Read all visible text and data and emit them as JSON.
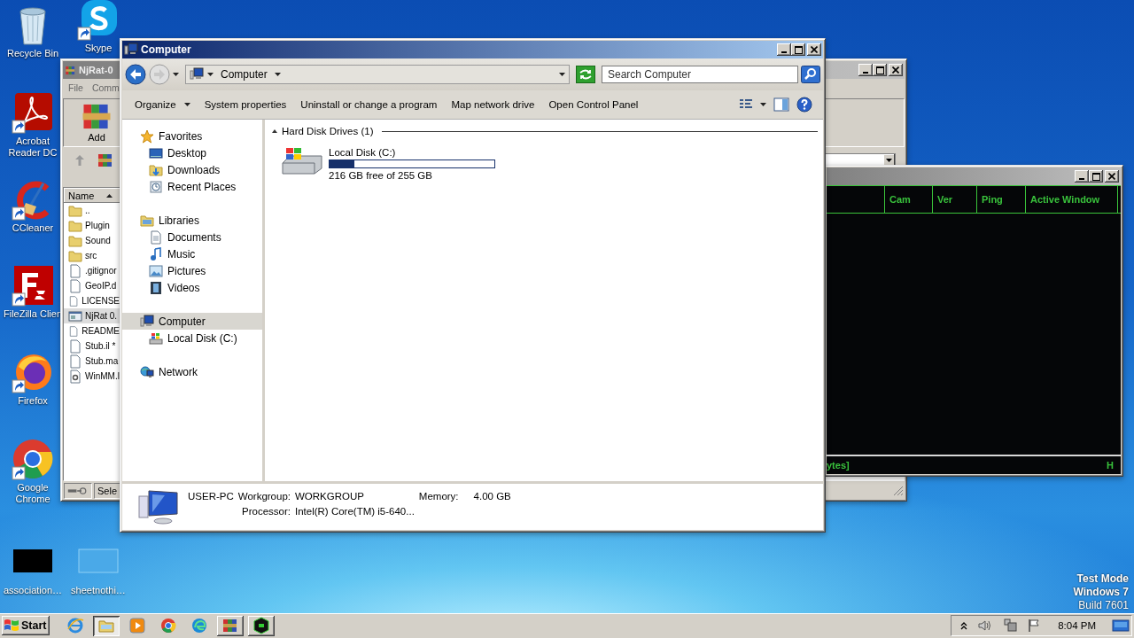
{
  "desktop": {
    "icons": [
      {
        "label": "Recycle Bin",
        "kind": "recycle"
      },
      {
        "label": "Skype",
        "kind": "skype"
      },
      {
        "label": "Acrobat Reader DC",
        "kind": "acrobat"
      },
      {
        "label": "CCleaner",
        "kind": "ccleaner"
      },
      {
        "label": "FileZilla Clien",
        "kind": "filezilla"
      },
      {
        "label": "Firefox",
        "kind": "firefox"
      },
      {
        "label": "Google Chrome",
        "kind": "chrome"
      },
      {
        "label": "association…",
        "kind": "blackfile"
      },
      {
        "label": "sheetnothi…",
        "kind": "blankfile"
      }
    ],
    "notice": [
      "Test Mode",
      "Windows 7",
      "Build 7601"
    ]
  },
  "archiver": {
    "title": "NjRat-0",
    "menu": [
      "File",
      "Comm"
    ],
    "toolbar": [
      "Add"
    ],
    "column": "Name",
    "files": [
      {
        "name": "..",
        "kind": "folder",
        "selected": false
      },
      {
        "name": "Plugin",
        "kind": "folder",
        "selected": false
      },
      {
        "name": "Sound",
        "kind": "folder",
        "selected": false
      },
      {
        "name": "src",
        "kind": "folder",
        "selected": false
      },
      {
        "name": ".gitignor",
        "kind": "file",
        "selected": false
      },
      {
        "name": "GeoIP.d",
        "kind": "file",
        "selected": false
      },
      {
        "name": "LICENSE",
        "kind": "file",
        "selected": false
      },
      {
        "name": "NjRat 0.",
        "kind": "app",
        "selected": true
      },
      {
        "name": "README",
        "kind": "file",
        "selected": false
      },
      {
        "name": "Stub.il *",
        "kind": "file",
        "selected": false
      },
      {
        "name": "Stub.ma",
        "kind": "file",
        "selected": false
      },
      {
        "name": "WinMM.l",
        "kind": "dll",
        "selected": false
      }
    ],
    "status": "Sele"
  },
  "rat_window": {
    "columns": [
      "Cam",
      "Ver",
      "Ping",
      "Active Window"
    ],
    "status_left": "ytes]",
    "status_right": "H"
  },
  "explorer": {
    "title": "Computer",
    "address": "Computer",
    "search": {
      "placeholder": "Search Computer"
    },
    "toolbar": [
      {
        "label": "Organize",
        "dropdown": true
      },
      {
        "label": "System properties",
        "dropdown": false
      },
      {
        "label": "Uninstall or change a program",
        "dropdown": false
      },
      {
        "label": "Map network drive",
        "dropdown": false
      },
      {
        "label": "Open Control Panel",
        "dropdown": false
      }
    ],
    "sidebar": [
      {
        "label": "Favorites",
        "kind": "star",
        "selected": false,
        "children": [
          {
            "label": "Desktop",
            "kind": "desktop",
            "selected": false
          },
          {
            "label": "Downloads",
            "kind": "downloads",
            "selected": false
          },
          {
            "label": "Recent Places",
            "kind": "recent",
            "selected": false
          }
        ]
      },
      {
        "label": "Libraries",
        "kind": "library",
        "selected": false,
        "children": [
          {
            "label": "Documents",
            "kind": "documents",
            "selected": false
          },
          {
            "label": "Music",
            "kind": "music",
            "selected": false
          },
          {
            "label": "Pictures",
            "kind": "pictures",
            "selected": false
          },
          {
            "label": "Videos",
            "kind": "videos",
            "selected": false
          }
        ]
      },
      {
        "label": "Computer",
        "kind": "computer",
        "selected": true,
        "children": [
          {
            "label": "Local Disk (C:)",
            "kind": "disk",
            "selected": false
          }
        ]
      },
      {
        "label": "Network",
        "kind": "network",
        "selected": false
      }
    ],
    "groups": [
      {
        "title": "Hard Disk Drives (1)",
        "expanded": true,
        "drives": [
          {
            "name": "Local Disk (C:)",
            "level": 0.15,
            "free": "216 GB free of 255 GB"
          }
        ]
      }
    ],
    "details": {
      "name": "USER-PC",
      "fields": [
        {
          "label": "Workgroup:",
          "value": "WORKGROUP"
        },
        {
          "label": "Memory:",
          "value": "4.00 GB"
        },
        {
          "label": "Processor:",
          "value": "Intel(R) Core(TM) i5-640..."
        }
      ]
    }
  },
  "taskbar": {
    "start": "Start",
    "apps": [
      {
        "kind": "ie",
        "open": false,
        "selected": false
      },
      {
        "kind": "explorer",
        "open": true,
        "selected": true
      },
      {
        "kind": "media",
        "open": false,
        "selected": false
      },
      {
        "kind": "chrome",
        "open": false,
        "selected": false
      },
      {
        "kind": "edge",
        "open": false,
        "selected": false
      },
      {
        "kind": "archiver",
        "open": true,
        "selected": false
      },
      {
        "kind": "rat",
        "open": true,
        "selected": false
      }
    ],
    "time": "8:04 PM"
  }
}
